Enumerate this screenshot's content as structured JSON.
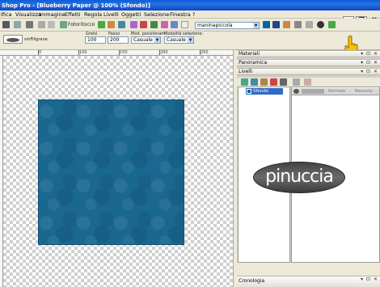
{
  "window": {
    "title": "Shop Pro - [Blueberry Paper @ 100% (Sfondo)]"
  },
  "menu": {
    "items": [
      "ifica",
      "Visualizza",
      "Immagine",
      "Effetti",
      "Regola",
      "Livelli",
      "Oggetti",
      "Selezione",
      "Finestra",
      "?"
    ]
  },
  "toolbar": {
    "tool_name": "Fotoritocco",
    "preset_value": "maninapiccola"
  },
  "options": {
    "preset_name": "smFiligrane",
    "size_label": "Grelsi",
    "size_value": "100",
    "step_label": "Passo",
    "step_value": "200",
    "placement_label": "Mod. posizionam.",
    "placement_value": "Casuale",
    "selection_label": "Modalità selezione:",
    "selection_value": "Casuale"
  },
  "ruler": {
    "labels": [
      "0",
      "100",
      "150",
      "200",
      "250"
    ]
  },
  "panels": {
    "materials": "Materiali",
    "overview": "Panoramica",
    "layers": "Livelli",
    "history": "Cronologia"
  },
  "layers": {
    "selected": "Sfondo",
    "props_label1": "Normale",
    "props_label2": "Nessuno"
  },
  "watermark_text": "pinuccia",
  "colors": {
    "titlebar": "#0a5fd8",
    "paper": "#1a6790",
    "selection": "#316ac5"
  }
}
